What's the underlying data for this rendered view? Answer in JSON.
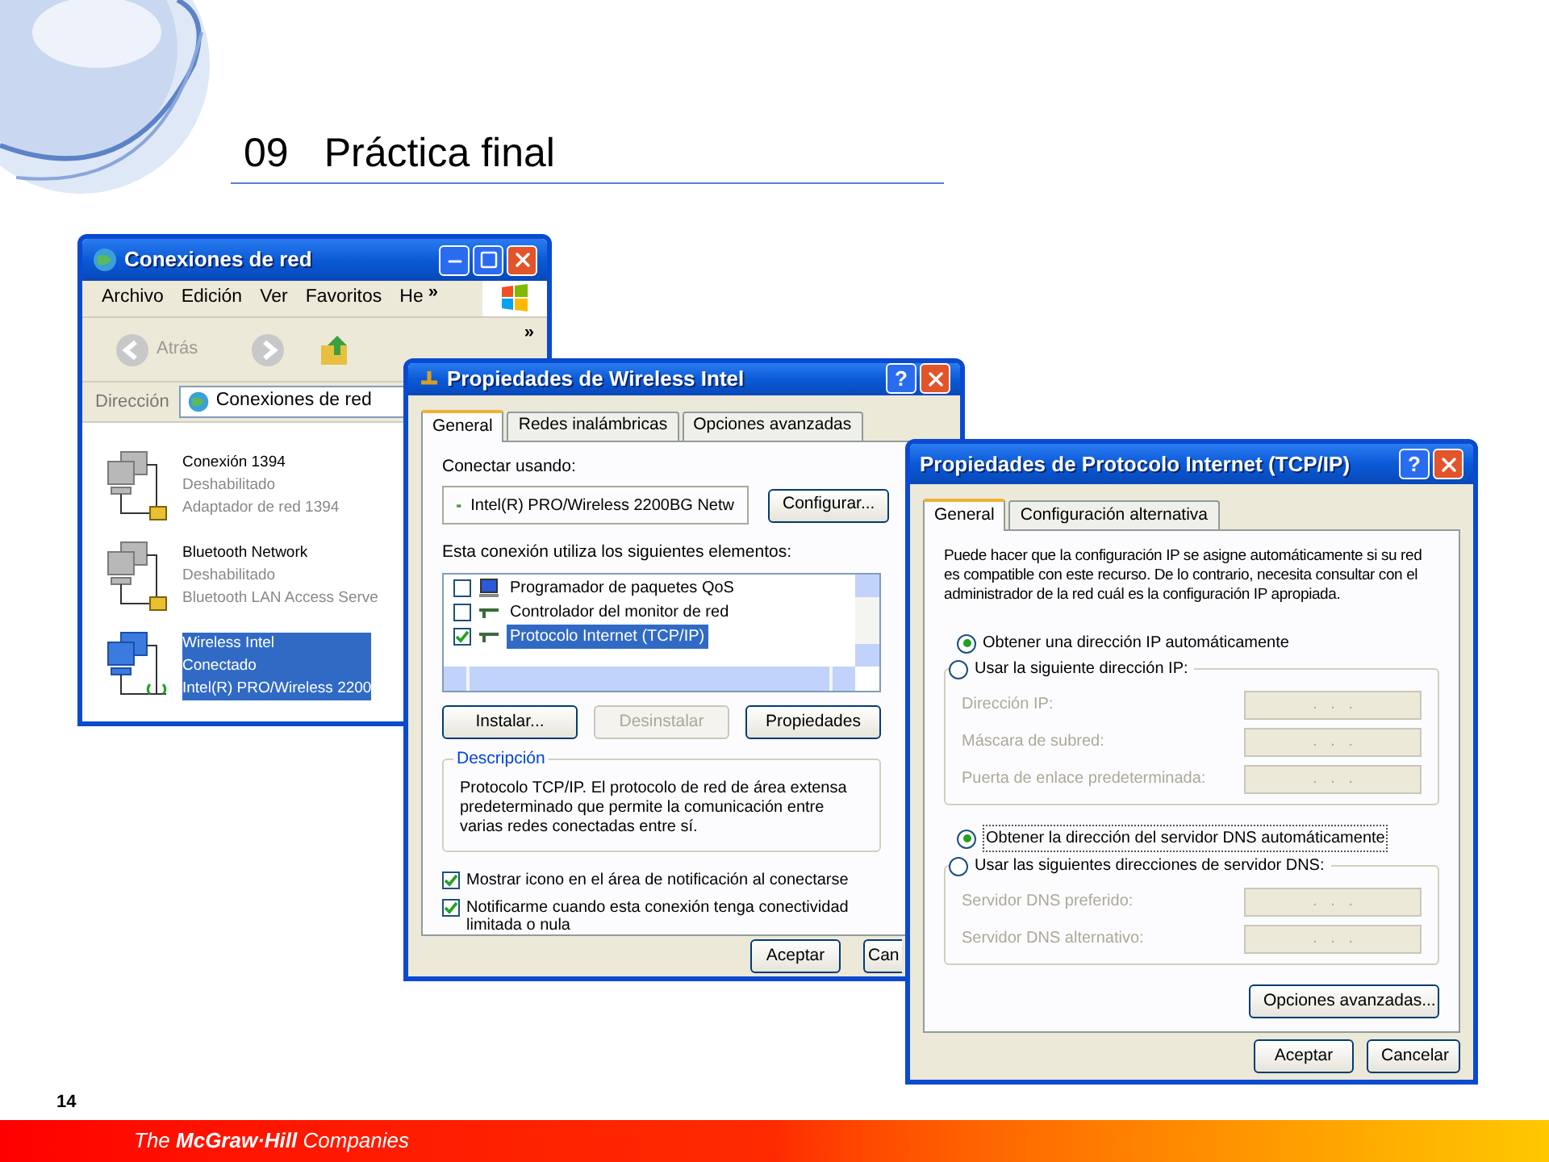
{
  "slide": {
    "number": "09",
    "title": "Práctica final",
    "page": "14",
    "footer_logo": "The **McGraw·Hill** Companies"
  },
  "network_connections": {
    "title": "Conexiones de red",
    "menu": [
      "Archivo",
      "Edición",
      "Ver",
      "Favoritos",
      "He"
    ],
    "menu_more": "»",
    "back_label": "Atrás",
    "toolbar_more": "»",
    "address_label": "Dirección",
    "address": "Conexiones de red",
    "connections": [
      {
        "kind": "wired",
        "name": "Conexión 1394",
        "status": "Deshabilitado",
        "device": "Adaptador de red 1394",
        "selected": false
      },
      {
        "kind": "wired",
        "name": "Bluetooth Network",
        "status": "Deshabilitado",
        "device": "Bluetooth LAN Access Serve",
        "selected": false
      },
      {
        "kind": "wireless",
        "name": "Wireless Intel",
        "status": "Conectado",
        "device": "Intel(R) PRO/Wireless 2200",
        "selected": true
      }
    ]
  },
  "wireless_properties": {
    "title": "Propiedades de Wireless Intel",
    "help_button": "?",
    "tabs": [
      {
        "label": "General",
        "selected": true
      },
      {
        "label": "Redes inalámbricas",
        "selected": false
      },
      {
        "label": "Opciones avanzadas",
        "selected": false
      }
    ],
    "connect_using_label": "Conectar usando:",
    "adapter": "Intel(R) PRO/Wireless 2200BG Netw",
    "configure_button": "Configurar...",
    "components_label": "Esta conexión utiliza los siguientes elementos:",
    "components": [
      {
        "kind": "scheduler",
        "label": "Programador de paquetes QoS",
        "checked": false,
        "selected": false
      },
      {
        "kind": "protocol",
        "label": "Controlador del monitor de red",
        "checked": false,
        "selected": false
      },
      {
        "kind": "protocol",
        "label": "Protocolo Internet (TCP/IP)",
        "checked": true,
        "selected": true
      }
    ],
    "buttons": [
      {
        "label": "Instalar...",
        "disabled": false
      },
      {
        "label": "Desinstalar",
        "disabled": true
      },
      {
        "label": "Propiedades",
        "disabled": false
      }
    ],
    "description_title": "Descripción",
    "description": "Protocolo TCP/IP. El protocolo de red de área extensa predeterminado que permite la comunicación entre varias redes conectadas entre sí.",
    "options": [
      {
        "label": "Mostrar icono en el área de notificación al conectarse",
        "checked": true
      },
      {
        "label": "Notificarme cuando esta conexión tenga conectividad limitada o nula",
        "checked": true
      }
    ],
    "ok_button": "Aceptar",
    "cancel_button": "Can"
  },
  "tcpip_properties": {
    "title": "Propiedades de Protocolo Internet (TCP/IP)",
    "help_button": "?",
    "tabs": [
      {
        "label": "General",
        "selected": true
      },
      {
        "label": "Configuración alternativa",
        "selected": false
      }
    ],
    "intro": "Puede hacer que la configuración IP se asigne automáticamente si su red es compatible con este recurso. De lo contrario, necesita consultar con el administrador de la red cuál es la configuración IP apropiada.",
    "ip_auto": {
      "label": "Obtener una dirección IP automáticamente",
      "selected": true
    },
    "ip_manual": {
      "label": "Usar la siguiente dirección IP:",
      "selected": false
    },
    "ip_fields": [
      {
        "label": "Dirección IP:",
        "value": ".   .   .",
        "disabled": true
      },
      {
        "label": "Máscara de subred:",
        "value": ".   .   .",
        "disabled": true
      },
      {
        "label": "Puerta de enlace predeterminada:",
        "value": ".   .   .",
        "disabled": true
      }
    ],
    "dns_auto": {
      "label": "Obtener la dirección del servidor DNS automáticamente",
      "selected": true
    },
    "dns_manual": {
      "label": "Usar las siguientes direcciones de servidor DNS:",
      "selected": false
    },
    "dns_fields": [
      {
        "label": "Servidor DNS preferido:",
        "value": ".   .   .",
        "disabled": true
      },
      {
        "label": "Servidor DNS alternativo:",
        "value": ".   .   .",
        "disabled": true
      }
    ],
    "advanced_button": "Opciones avanzadas...",
    "ok_button": "Aceptar",
    "cancel_button": "Cancelar"
  }
}
